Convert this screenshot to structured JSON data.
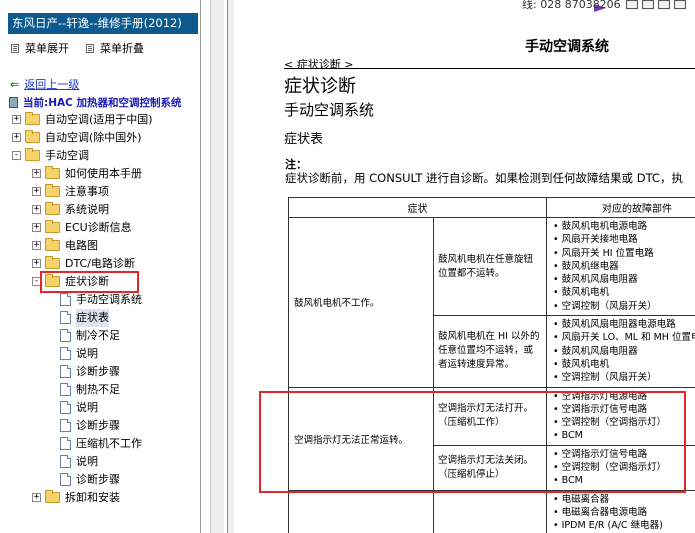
{
  "sidebar": {
    "title": "东风日产--轩逸--维修手册(2012)",
    "expand_label": "菜单展开",
    "collapse_label": "菜单折叠",
    "back_label": "返回上一级",
    "current_label": "当前:HAC 加热器和空调控制系统",
    "tree": [
      {
        "label": "自动空调(适用于中国)",
        "level": 0,
        "type": "folder",
        "expander": "+"
      },
      {
        "label": "自动空调(除中国外)",
        "level": 0,
        "type": "folder",
        "expander": "+"
      },
      {
        "label": "手动空调",
        "level": 0,
        "type": "folder",
        "expander": "-"
      },
      {
        "label": "如何使用本手册",
        "level": 1,
        "type": "folder",
        "expander": "+"
      },
      {
        "label": "注意事项",
        "level": 1,
        "type": "folder",
        "expander": "+"
      },
      {
        "label": "系统说明",
        "level": 1,
        "type": "folder",
        "expander": "+"
      },
      {
        "label": "ECU诊断信息",
        "level": 1,
        "type": "folder",
        "expander": "+"
      },
      {
        "label": "电路图",
        "level": 1,
        "type": "folder",
        "expander": "+"
      },
      {
        "label": "DTC/电路诊断",
        "level": 1,
        "type": "folder",
        "expander": "+"
      },
      {
        "label": "症状诊断",
        "level": 1,
        "type": "folder-open",
        "expander": "-"
      },
      {
        "label": "手动空调系统",
        "level": 2,
        "type": "page"
      },
      {
        "label": "症状表",
        "level": 2,
        "type": "page",
        "selected": true
      },
      {
        "label": "制冷不足",
        "level": 2,
        "type": "page"
      },
      {
        "label": "说明",
        "level": 2,
        "type": "page"
      },
      {
        "label": "诊断步骤",
        "level": 2,
        "type": "page"
      },
      {
        "label": "制热不足",
        "level": 2,
        "type": "page"
      },
      {
        "label": "说明",
        "level": 2,
        "type": "page"
      },
      {
        "label": "诊断步骤",
        "level": 2,
        "type": "page"
      },
      {
        "label": "压缩机不工作",
        "level": 2,
        "type": "page"
      },
      {
        "label": "说明",
        "level": 2,
        "type": "page"
      },
      {
        "label": "诊断步骤",
        "level": 2,
        "type": "page"
      },
      {
        "label": "拆卸和安装",
        "level": 1,
        "type": "folder",
        "expander": "+"
      }
    ]
  },
  "document": {
    "phone": "线: 028 87038206",
    "system_title": "手动空调系统",
    "breadcrumb": "< 症状诊断 >",
    "heading1": "症状诊断",
    "heading2": "手动空调系统",
    "heading3": "症状表",
    "note_label": "注：",
    "note_text": "症状诊断前，用 CONSULT 进行自诊断。如果检测到任何故障结果或 DTC，执",
    "table": {
      "col_symptom": "症状",
      "col_parts": "对应的故障部件",
      "rows": [
        {
          "symptom": "鼓风机电机不工作。",
          "sub": "鼓风机电机在任意旋钮位置都不运转。",
          "parts": [
            "鼓风机电机电源电路",
            "风扇开关接地电路",
            "风扇开关 HI 位置电路",
            "鼓风机继电器",
            "鼓风机风扇电阻器",
            "鼓风机电机",
            "空调控制（风扇开关）"
          ]
        },
        {
          "symptom": "",
          "sub": "鼓风机电机在 HI 以外的任意位置均不运转，或者运转速度异常。",
          "parts": [
            "鼓风机风扇电阻器电源电路",
            "风扇开关 LO、ML 和 MH 位置电",
            "鼓风机风扇电阻器",
            "鼓风机电机",
            "空调控制（风扇开关）"
          ]
        },
        {
          "symptom": "空调指示灯无法正常运转。",
          "sub": "空调指示灯无法打开。（压缩机工作）",
          "parts": [
            "空调指示灯电源电路",
            "空调指示灯信号电路",
            "空调控制（空调指示灯）",
            "BCM"
          ]
        },
        {
          "symptom": "",
          "sub": "空调指示灯无法关闭。（压缩机停止）",
          "parts": [
            "空调指示灯信号电路",
            "空调控制（空调指示灯）",
            "BCM"
          ]
        },
        {
          "symptom": "",
          "sub": "",
          "parts": [
            "电磁离合器",
            "电磁离合器电源电路",
            "IPDM E/R (A/C 继电器)"
          ]
        }
      ]
    }
  },
  "colors": {
    "title_bar": "#0a5a8e",
    "highlight": "#e0282a",
    "link": "#1a3ac7"
  }
}
